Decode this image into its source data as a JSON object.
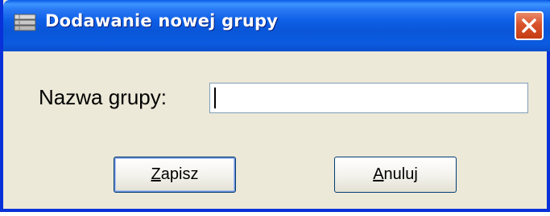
{
  "window": {
    "title": "Dodawanie nowej grupy",
    "icon": "db-table-icon"
  },
  "form": {
    "label": "Nazwa grupy:",
    "input_value": "",
    "input_placeholder": ""
  },
  "buttons": {
    "save": {
      "accel": "Z",
      "rest": "apisz"
    },
    "cancel": {
      "accel": "A",
      "rest": "nuluj"
    }
  },
  "colors": {
    "titlebar": "#0a56d8",
    "window_bg": "#ece9d8",
    "close": "#d8532b"
  }
}
